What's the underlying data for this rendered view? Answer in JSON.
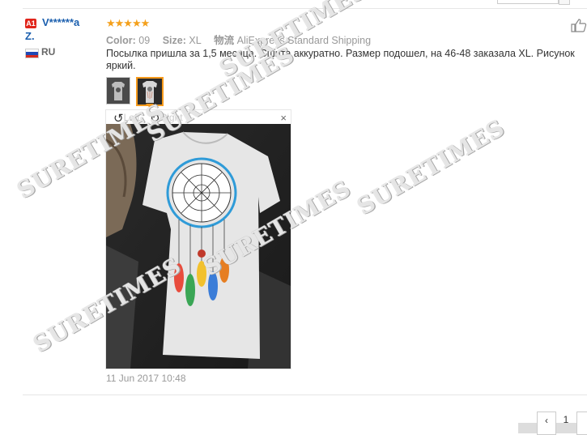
{
  "review": {
    "badge": "A1",
    "username_line1": "V******a",
    "username_line2": "Z.",
    "country": "RU",
    "stars": "★★★★★",
    "color_label": "Color:",
    "color_value": "09",
    "size_label": "Size:",
    "size_value": "XL",
    "shipping_label": "物流",
    "shipping_value": "AliExpress Standard Shipping",
    "text": "Посылка пришла за 1,5 месяца. Сшита аккуратно. Размер подошел, на 46-48 заказала XL. Рисунок яркий.",
    "date": "11 Jun 2017 10:48"
  },
  "viewer": {
    "rotate_left": "Left",
    "rotate_right": "Right",
    "close": "×"
  },
  "pagination": {
    "prev": "‹",
    "page": "1"
  },
  "watermark": "SURETIMES",
  "colors": {
    "link_blue": "#1b5fae",
    "star_orange": "#f4a01b",
    "selected_border": "#f79a1b",
    "badge_red": "#e1251b"
  }
}
